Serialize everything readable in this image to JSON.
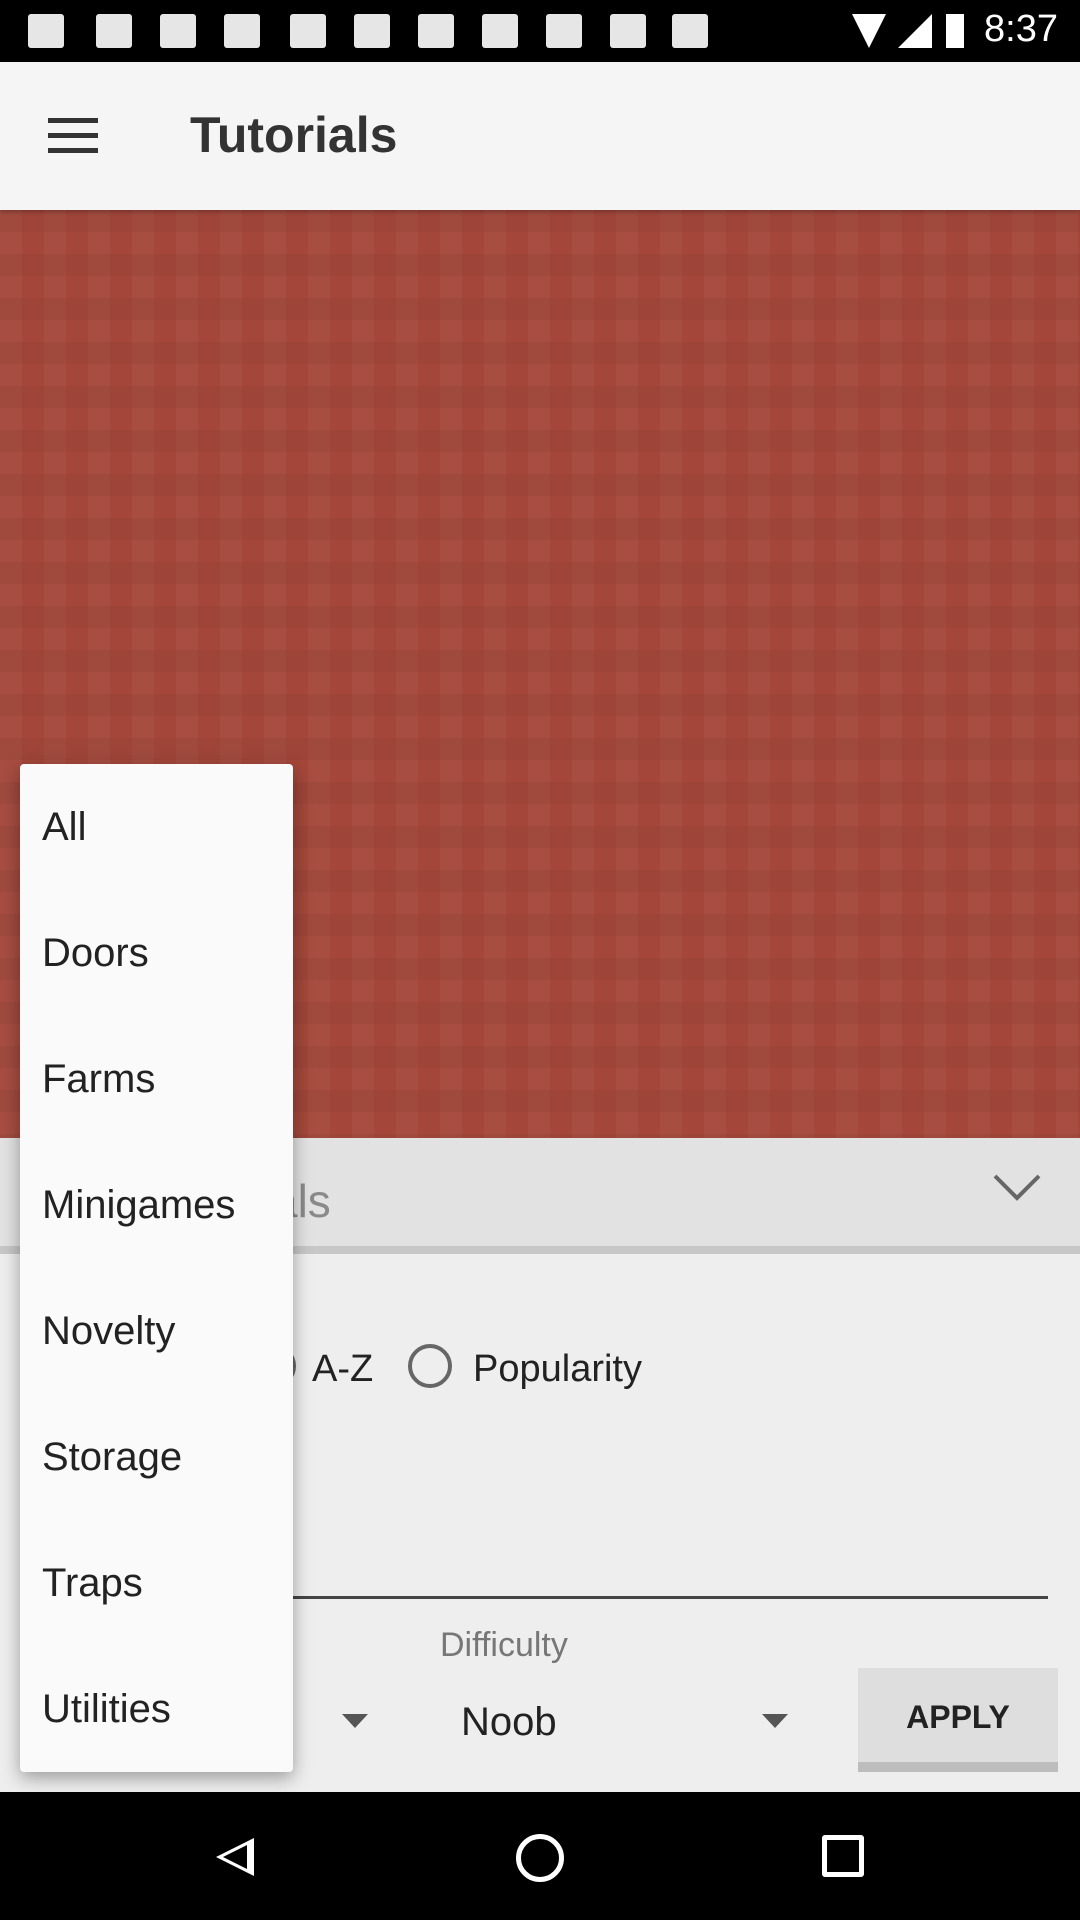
{
  "status_bar": {
    "time": "8:37"
  },
  "app_bar": {
    "title": "Tutorials"
  },
  "category_dropdown": {
    "visible_text": "als"
  },
  "sort": {
    "options": [
      {
        "label": "A-Z",
        "selected": false
      },
      {
        "label": "Popularity",
        "selected": false
      }
    ]
  },
  "difficulty": {
    "label": "Difficulty",
    "value": "Noob"
  },
  "apply_label": "APPLY",
  "popup_menu": {
    "items": [
      "All",
      "Doors",
      "Farms",
      "Minigames",
      "Novelty",
      "Storage",
      "Traps",
      "Utilities"
    ]
  },
  "colors": {
    "banner": "#a4473a",
    "app_bar": "#f5f5f5"
  }
}
